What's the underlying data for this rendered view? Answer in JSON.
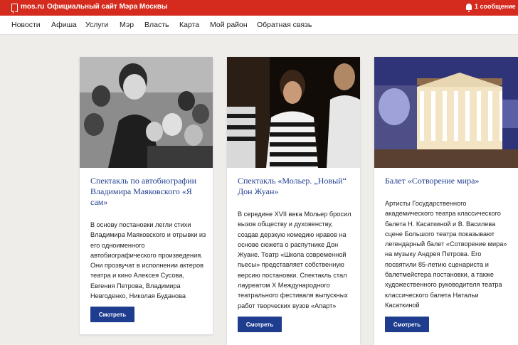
{
  "header": {
    "site_name": "mos.ru",
    "site_title": "Официальный сайт Мэра Москвы",
    "messages": "1 сообщение"
  },
  "nav": {
    "items": [
      "Новости",
      "Афиша",
      "Услуги",
      "Мэр",
      "Власть",
      "Карта",
      "Мой район",
      "Обратная связь"
    ]
  },
  "cards": [
    {
      "title": "Спектакль по автобиографии Владимира Маяковского «Я сам»",
      "description": "В основу постановки легли стихи Владимира Маяковского и отрывки из его одноименного автобиографического произведения. Они прозвучат в исполнении актеров театра и кино Алексея Сусова, Евгения Петрова, Владимира Невгоденко, Николая Буданова",
      "button": "Смотреть"
    },
    {
      "title": "Спектакль «Мольер. „Новый“ Дон Жуан»",
      "description": "В середине XVII века Мольер бросил вызов обществу и духовенству, создав дерзкую комедию нравов на основе сюжета о распутнике Дон Жуане. Театр «Школа современной пьесы» представляет собственную версию постановки. Спектакль стал лауреатом X Международного театрального фестиваля выпускных работ творческих вузов «Апарт»",
      "button": "Смотреть"
    },
    {
      "title": "Балет «Сотворение мира»",
      "description": "Артисты Государственного академического театра классического балета Н. Касаткиной и В. Василева сцене Большого театра показывают легендарный балет «Сотворение мира» на музыку Андрея Петрова. Его посвятили 85-летию сценариста и балетмейстера постановки, а также художественного руководителя театра классического балета Натальи Касаткиной",
      "button": "Смотреть"
    }
  ]
}
